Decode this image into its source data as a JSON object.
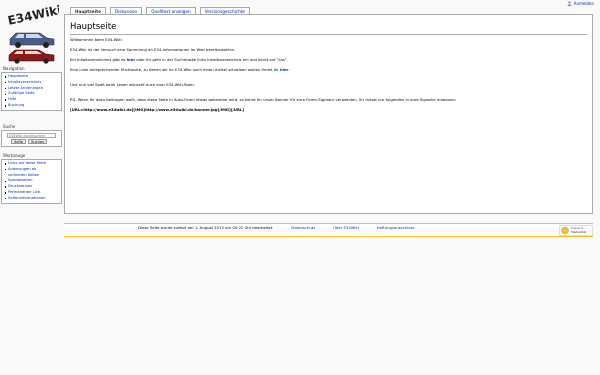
{
  "personal": {
    "login_label": "Anmelden"
  },
  "tabs": [
    {
      "label": "Hauptseite",
      "selected": true
    },
    {
      "label": "Diskussion",
      "selected": false
    },
    {
      "label": "Quelltext anzeigen",
      "selected": false
    },
    {
      "label": "Versionsgeschichte",
      "selected": false
    }
  ],
  "logo": {
    "text": "E34Wiki"
  },
  "content": {
    "title": "Hauptseite",
    "p1": "Willkommen beim E34-Wiki",
    "p2": "E34-Wiki ist der Versuch eine Sammlung an E34-Informationen im Web bereitzustellen.",
    "p3_a": "Ein Inhaltsverzeichnis gibt es ",
    "p3_link": "hier",
    "p3_b": " oder Ihr geht in der Suchmaske links Inhaltsverzeichnis ein und klickt auf \"Los\".",
    "p4_a": "Eine Liste entsprechender Stichworte, zu denen wir im E34-Wiki noch einen Artikel schreiben wollen findet Ihr ",
    "p4_link": "hier",
    "p4_b": ".",
    "p5": "Und nun viel Spaß beim Lesen wünscht euch euer E34-Wiki-Team.",
    "p6": "P.S. Wenn Ihr dazu beitragen wollt, dass diese Seite in Auto-Foren etwas bekannter wird, so könnt Ihr unser Banner für eure Foren-Signatur verwenden. Ihr müsst nur folgendes in eure Signatur einbauen:",
    "p7": "[URL=http://www.e34wiki.de][IMG]http://www.e34wiki.de/banner.jpg[/IMG][/URL]"
  },
  "navigation": {
    "heading": "Navigation",
    "items": [
      "Hauptseite",
      "Inhaltsverzeichnis",
      "Letzte Änderungen",
      "Zufällige Seite",
      "Hilfe",
      "Buchung"
    ]
  },
  "search": {
    "heading": "Suche",
    "placeholder": "E34Wiki durchsuchen",
    "go_label": "Seite",
    "search_label": "Suchen"
  },
  "toolbox": {
    "heading": "Werkzeuge",
    "items": [
      "Links auf diese Seite",
      "Änderungen an",
      "verlinkten Seiten",
      "Spezialseiten",
      "Druckversion",
      "Permanenter Link",
      "Seiteninformationen"
    ]
  },
  "footer": {
    "lastmod": "Diese Seite wurde zuletzt am 1. August 2013 um 00:22 Uhr bearbeitet.",
    "links": [
      "Datenschutz",
      "Über E34Wiki",
      "Haftungsausschluss"
    ],
    "powered": "Powered by MediaWiki"
  },
  "colors": {
    "link": "#002bb8",
    "footer_border": "#fabd23",
    "car_blue": "#4a5d8a",
    "car_red": "#8b1a1a"
  }
}
